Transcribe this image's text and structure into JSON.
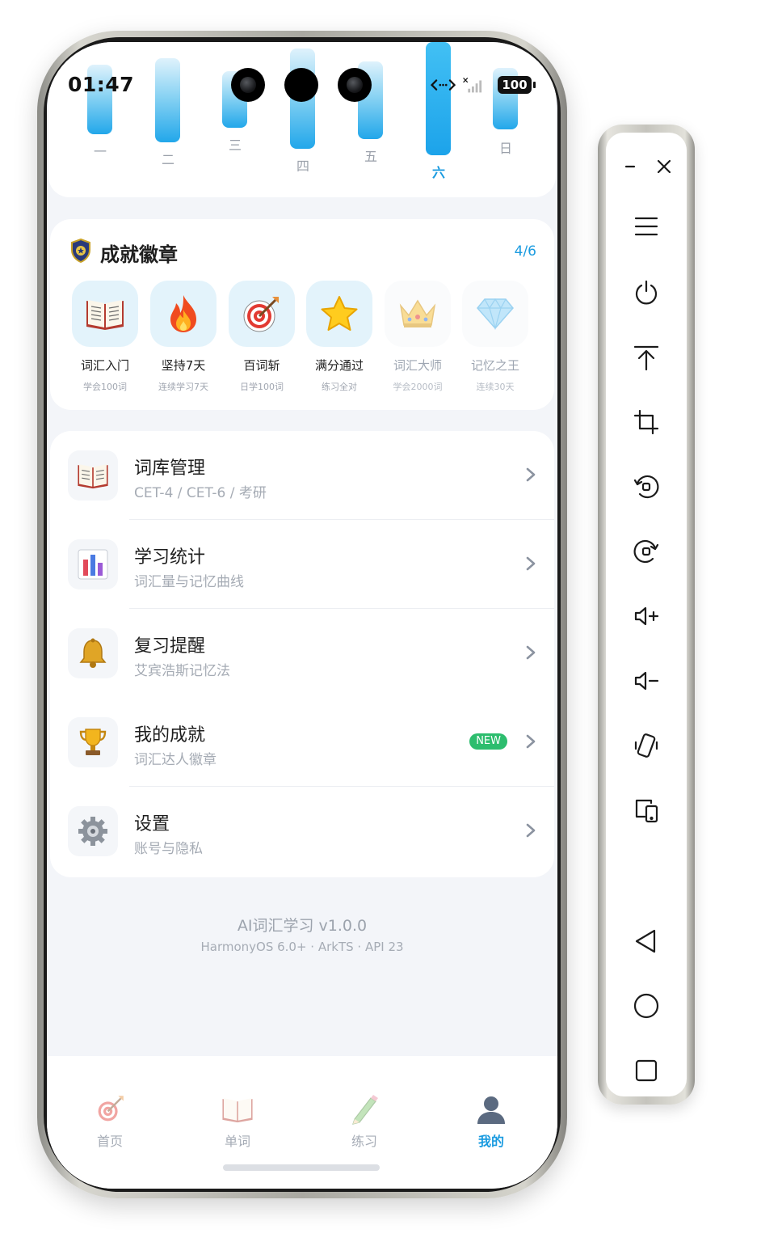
{
  "status_bar": {
    "time": "01:47",
    "battery": "100"
  },
  "week_chart": {
    "days": [
      "一",
      "二",
      "三",
      "四",
      "五",
      "六",
      "日"
    ],
    "active_day": "六",
    "accent": "#1a9be0"
  },
  "achievements": {
    "title": "成就徽章",
    "count": "4/6",
    "items": [
      {
        "icon": "book-icon",
        "name": "词汇入门",
        "desc": "学会100词",
        "unlocked": true
      },
      {
        "icon": "fire-icon",
        "name": "坚持7天",
        "desc": "连续学习7天",
        "unlocked": true
      },
      {
        "icon": "target-icon",
        "name": "百词斩",
        "desc": "日学100词",
        "unlocked": true
      },
      {
        "icon": "star-icon",
        "name": "满分通过",
        "desc": "练习全对",
        "unlocked": true
      },
      {
        "icon": "crown-icon",
        "name": "词汇大师",
        "desc": "学会2000词",
        "unlocked": false
      },
      {
        "icon": "diamond-icon",
        "name": "记忆之王",
        "desc": "连续30天",
        "unlocked": false
      }
    ]
  },
  "menu": {
    "items": [
      {
        "icon": "book-icon",
        "title": "词库管理",
        "subtitle": "CET-4 / CET-6 / 考研"
      },
      {
        "icon": "chart-icon",
        "title": "学习统计",
        "subtitle": "词汇量与记忆曲线"
      },
      {
        "icon": "bell-icon",
        "title": "复习提醒",
        "subtitle": "艾宾浩斯记忆法"
      },
      {
        "icon": "trophy-icon",
        "title": "我的成就",
        "subtitle": "词汇达人徽章",
        "badge": "NEW"
      },
      {
        "icon": "gear-icon",
        "title": "设置",
        "subtitle": "账号与隐私"
      }
    ]
  },
  "footer": {
    "app_version": "AI词汇学习 v1.0.0",
    "platform": "HarmonyOS 6.0+ · ArkTS · API 23"
  },
  "tabs": [
    {
      "icon": "target-icon",
      "label": "首页",
      "active": false
    },
    {
      "icon": "book-icon",
      "label": "单词",
      "active": false
    },
    {
      "icon": "pencil-icon",
      "label": "练习",
      "active": false
    },
    {
      "icon": "user-icon",
      "label": "我的",
      "active": true
    }
  ],
  "emulator_toolbar": {
    "buttons": [
      "minimize-icon",
      "close-icon",
      "menu-icon",
      "power-icon",
      "pin-top-icon",
      "crop-icon",
      "rotate-left-icon",
      "rotate-right-icon",
      "volume-up-icon",
      "volume-down-icon",
      "shake-icon",
      "multi-device-icon",
      "back-icon",
      "home-icon",
      "recents-icon"
    ]
  }
}
